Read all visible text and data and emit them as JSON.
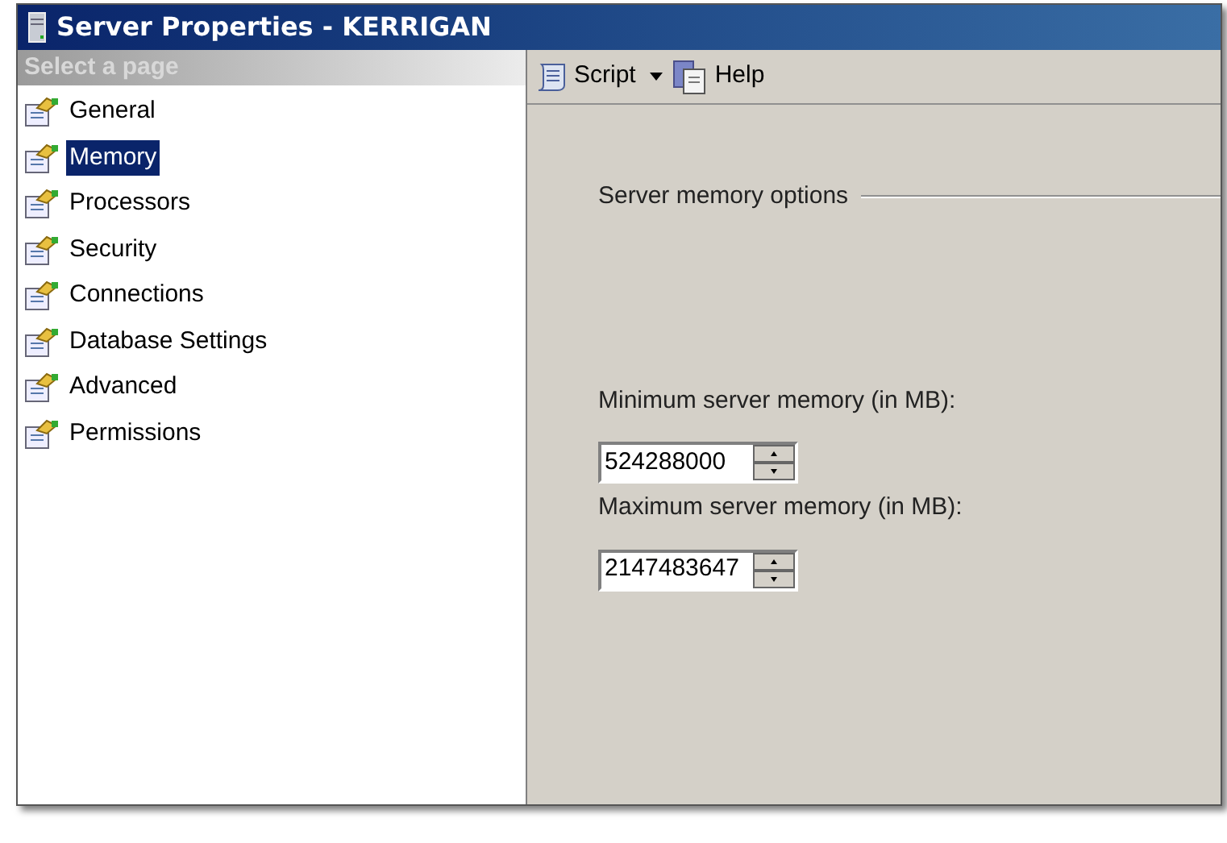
{
  "window": {
    "title": "Server Properties - KERRIGAN"
  },
  "sidebar": {
    "header": "Select a page",
    "items": [
      {
        "label": "General",
        "selected": false
      },
      {
        "label": "Memory",
        "selected": true
      },
      {
        "label": "Processors",
        "selected": false
      },
      {
        "label": "Security",
        "selected": false
      },
      {
        "label": "Connections",
        "selected": false
      },
      {
        "label": "Database Settings",
        "selected": false
      },
      {
        "label": "Advanced",
        "selected": false
      },
      {
        "label": "Permissions",
        "selected": false
      }
    ]
  },
  "toolbar": {
    "script": "Script",
    "help": "Help"
  },
  "group": {
    "title": "Server memory options",
    "fields": [
      {
        "label": "Minimum server memory (in MB):",
        "value": "524288000"
      },
      {
        "label": "Maximum server memory (in MB):",
        "value": "2147483647"
      }
    ]
  }
}
